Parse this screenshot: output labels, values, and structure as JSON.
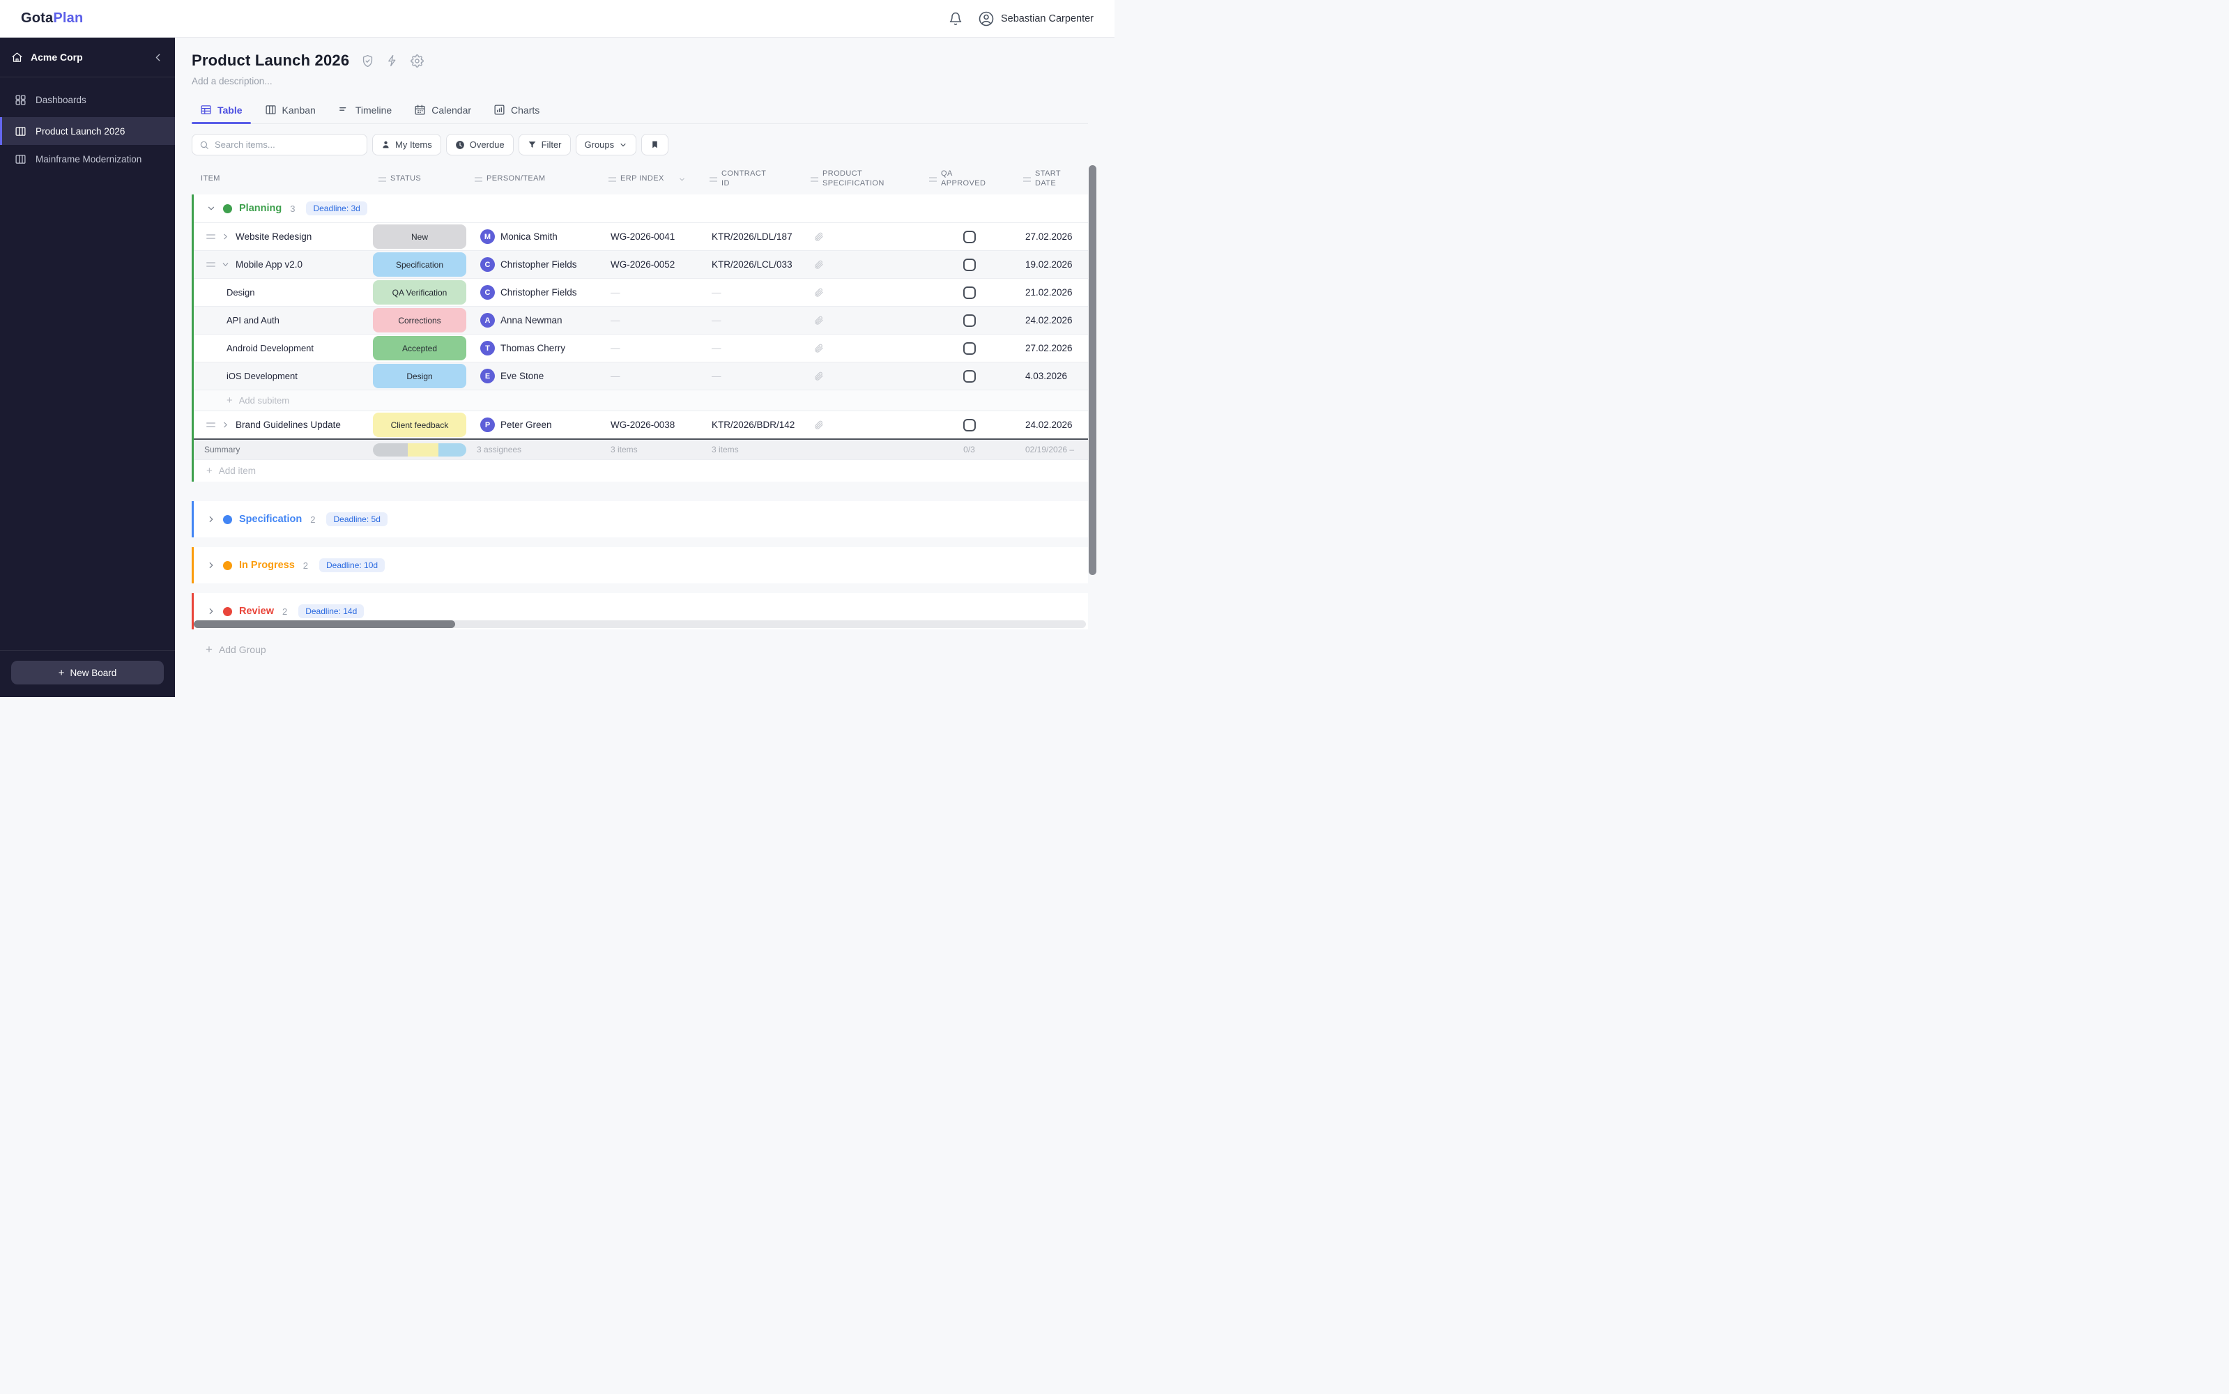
{
  "topbar": {
    "logo_primary": "Gota",
    "logo_accent": "Plan",
    "user_name": "Sebastian Carpenter"
  },
  "sidebar": {
    "workspace_name": "Acme Corp",
    "items": [
      {
        "label": "Dashboards"
      },
      {
        "label": "Product Launch 2026"
      },
      {
        "label": "Mainframe Modernization"
      }
    ],
    "new_board_label": "New Board"
  },
  "board": {
    "title": "Product Launch 2026",
    "description_placeholder": "Add a description..."
  },
  "tabs": [
    {
      "label": "Table"
    },
    {
      "label": "Kanban"
    },
    {
      "label": "Timeline"
    },
    {
      "label": "Calendar"
    },
    {
      "label": "Charts"
    }
  ],
  "toolbar": {
    "search_placeholder": "Search items...",
    "my_items_label": "My Items",
    "overdue_label": "Overdue",
    "filter_label": "Filter",
    "groups_label": "Groups"
  },
  "columns": {
    "item": "ITEM",
    "status": "STATUS",
    "person": "PERSON/TEAM",
    "erp": "ERP INDEX",
    "contract_1": "CONTRACT",
    "contract_2": "ID",
    "spec_1": "PRODUCT",
    "spec_2": "SPECIFICATION",
    "qa_1": "QA",
    "qa_2": "APPROVED",
    "date_1": "START",
    "date_2": "DATE"
  },
  "colors": {
    "accent": "#5b5fe8",
    "deadline_badge_bg": "#e9effc",
    "deadline_badge_text": "#2c6be0"
  },
  "groups": [
    {
      "name": "Planning",
      "color": "#3ea04d",
      "count": "3",
      "deadline": "Deadline: 3d",
      "rows": [
        {
          "name": "Website Redesign",
          "status": "New",
          "status_color": "#d8d8db",
          "avatar": "M",
          "person": "Monica Smith",
          "erp": "WG-2026-0041",
          "contract": "KTR/2026/LDL/187",
          "start": "27.02.2026"
        },
        {
          "name": "Mobile App v2.0",
          "status": "Specification",
          "status_color": "#a8d7f5",
          "avatar": "C",
          "person": "Christopher Fields",
          "erp": "WG-2026-0052",
          "contract": "KTR/2026/LCL/033",
          "start": "19.02.2026"
        },
        {
          "name": "Design",
          "status": "QA Verification",
          "status_color": "#c6e5c8",
          "avatar": "C",
          "person": "Christopher Fields",
          "erp": "—",
          "contract": "—",
          "start": "21.02.2026"
        },
        {
          "name": "API and Auth",
          "status": "Corrections",
          "status_color": "#f8c5cb",
          "avatar": "A",
          "person": "Anna Newman",
          "erp": "—",
          "contract": "—",
          "start": "24.02.2026"
        },
        {
          "name": "Android Development",
          "status": "Accepted",
          "status_color": "#8bcd92",
          "avatar": "T",
          "person": "Thomas Cherry",
          "erp": "—",
          "contract": "—",
          "start": "27.02.2026"
        },
        {
          "name": "iOS Development",
          "status": "Design",
          "status_color": "#a8d7f5",
          "avatar": "E",
          "person": "Eve Stone",
          "erp": "—",
          "contract": "—",
          "start": "4.03.2026"
        },
        {
          "name": "Brand Guidelines Update",
          "status": "Client feedback",
          "status_color": "#f9f2ae",
          "avatar": "P",
          "person": "Peter Green",
          "erp": "WG-2026-0038",
          "contract": "KTR/2026/BDR/142",
          "start": "24.02.2026"
        }
      ],
      "add_subitem_label": "Add subitem",
      "add_item_label": "Add item",
      "summary": {
        "label": "Summary",
        "assignees": "3 assignees",
        "erp_count": "3 items",
        "contract_count": "3 items",
        "qa_ratio": "0/3",
        "date_range": "02/19/2026 –",
        "segments": [
          {
            "color": "#cdd0d4",
            "pct": "37%"
          },
          {
            "color": "#f7f0ad",
            "pct": "33%"
          },
          {
            "color": "#a9d7ef",
            "pct": "30%"
          }
        ]
      }
    },
    {
      "name": "Specification",
      "color": "#4285f4",
      "count": "2",
      "deadline": "Deadline: 5d"
    },
    {
      "name": "In Progress",
      "color": "#fb9c0c",
      "count": "2",
      "deadline": "Deadline: 10d"
    },
    {
      "name": "Review",
      "color": "#e9453a",
      "count": "2",
      "deadline": "Deadline: 14d"
    }
  ],
  "footer": {
    "add_group_label": "Add Group"
  }
}
